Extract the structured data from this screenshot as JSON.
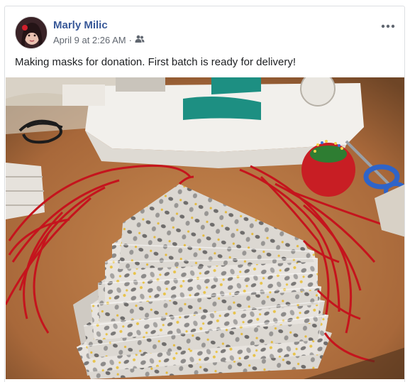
{
  "post": {
    "author": "Marly Milic",
    "timestamp": "April 9 at 2:26 AM",
    "separator": "·",
    "audience_icon": "friends-icon",
    "menu_icon": "more-options-icon",
    "text": "Making masks for donation. First batch is ready for delivery!"
  },
  "colors": {
    "link": "#385898",
    "meta": "#616770",
    "text": "#1c1e21",
    "border": "#dddfe2"
  }
}
